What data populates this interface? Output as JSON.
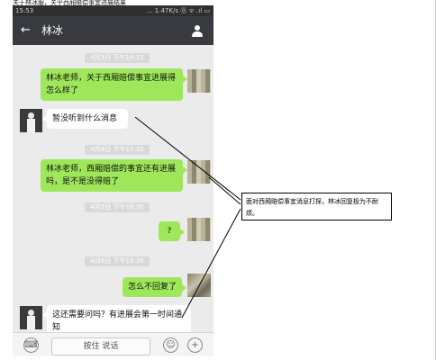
{
  "caption_top": "关于林冰服，关乎西厢赔偿事宜进展结果",
  "statusbar": {
    "time": "15:53",
    "right": "... 1.47K/s ⓪ ᯤ .ıl ▭"
  },
  "nav": {
    "back": "←",
    "title": "林冰"
  },
  "messages": [
    {
      "kind": "time",
      "text": "4月3日 下午14:12"
    },
    {
      "kind": "me",
      "text": "林冰老师，关于西厢赔偿事宜进展得怎么样了"
    },
    {
      "kind": "other",
      "text": "暂没听到什么消息"
    },
    {
      "kind": "time",
      "text": "4月4日 下午17:32"
    },
    {
      "kind": "me",
      "text": "林冰老师，西厢赔偿的事宜还有进展吗，是不是没得赔了"
    },
    {
      "kind": "time",
      "text": "4月5日 下午16:30"
    },
    {
      "kind": "me",
      "text": "?"
    },
    {
      "kind": "time",
      "text": "4月6日 下午13:38"
    },
    {
      "kind": "me",
      "text": "怎么不回复了"
    },
    {
      "kind": "other",
      "text": "这还需要问吗？有进展会第一时间通知"
    }
  ],
  "input": {
    "voice_icon": "keyboard-icon",
    "hold_to_talk": "按住 说话",
    "emoji_icon": "emoji-icon",
    "plus": "+"
  },
  "annotation": "面对西厢赔偿事宜消息打探，林冰回复极为不耐烦。"
}
